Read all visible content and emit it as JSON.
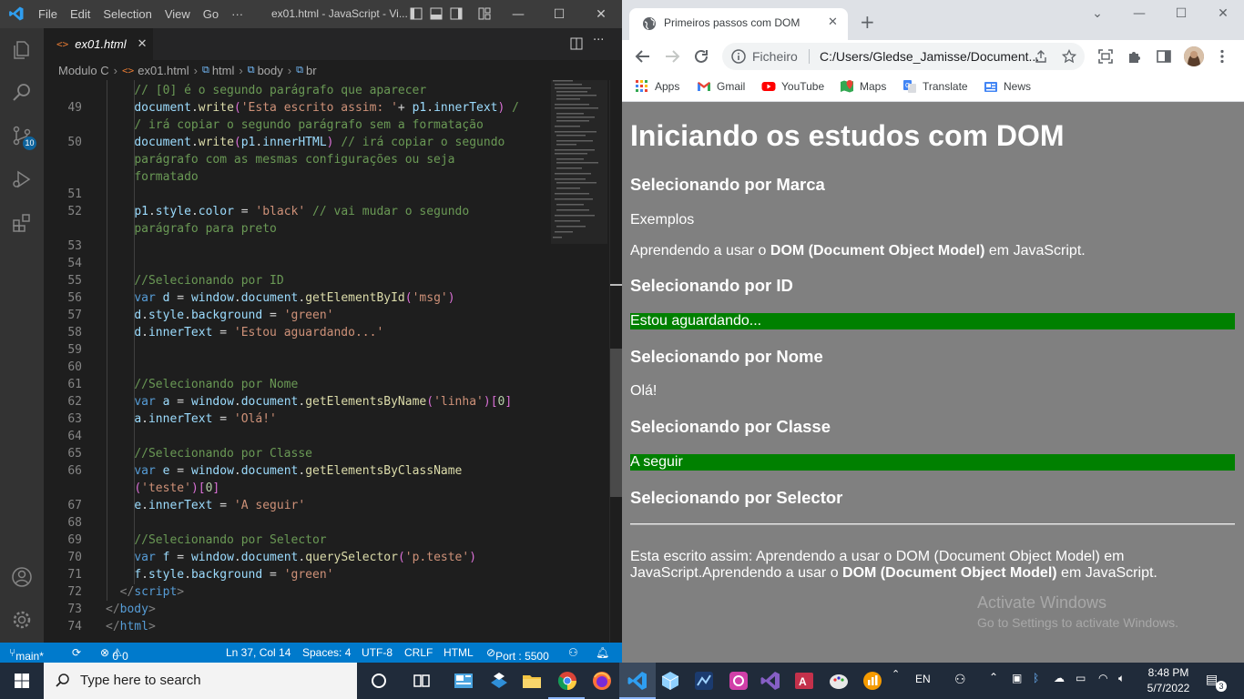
{
  "vscode": {
    "menu": [
      "File",
      "Edit",
      "Selection",
      "View",
      "Go",
      "···"
    ],
    "window_title": "ex01.html - JavaScript - Vi...",
    "tab": {
      "name": "ex01.html",
      "close": "✕"
    },
    "breadcrumb": [
      "Modulo C",
      "ex01.html",
      "html",
      "body",
      "br"
    ],
    "source_control_badge": "10",
    "code_lines": [
      {
        "num": "",
        "html": "    <span class=\"c\">// [0] é o segundo parágrafo que aparecer</span>"
      },
      {
        "num": "49",
        "html": "    <span class=\"v\">document</span>.<span class=\"f\">write</span><span class=\"br2\">(</span><span class=\"s\">'Esta escrito assim: '</span>+ <span class=\"v\">p1</span>.<span class=\"v\">innerText</span><span class=\"br2\">)</span> <span class=\"c\">/</span>"
      },
      {
        "num": "",
        "html": "    <span class=\"c\">/ irá copiar o segundo parágrafo sem a formatação</span>"
      },
      {
        "num": "50",
        "html": "    <span class=\"v\">document</span>.<span class=\"f\">write</span><span class=\"br2\">(</span><span class=\"v\">p1</span>.<span class=\"v\">innerHTML</span><span class=\"br2\">)</span> <span class=\"c\">// irá copiar o segundo</span>"
      },
      {
        "num": "",
        "html": "    <span class=\"c\">parágrafo com as mesmas configurações ou seja</span>"
      },
      {
        "num": "",
        "html": "    <span class=\"c\">formatado</span>"
      },
      {
        "num": "51",
        "html": ""
      },
      {
        "num": "52",
        "html": "    <span class=\"v\">p1</span>.<span class=\"v\">style</span>.<span class=\"v\">color</span> = <span class=\"s\">'black'</span> <span class=\"c\">// vai mudar o segundo</span>"
      },
      {
        "num": "",
        "html": "    <span class=\"c\">parágrafo para preto</span>"
      },
      {
        "num": "53",
        "html": ""
      },
      {
        "num": "54",
        "html": ""
      },
      {
        "num": "55",
        "html": "    <span class=\"c\">//Selecionando por ID</span>"
      },
      {
        "num": "56",
        "html": "    <span class=\"k\">var</span> <span class=\"v\">d</span> = <span class=\"v\">window</span>.<span class=\"v\">document</span>.<span class=\"f\">getElementById</span><span class=\"br2\">(</span><span class=\"s\">'msg'</span><span class=\"br2\">)</span>"
      },
      {
        "num": "57",
        "html": "    <span class=\"v\">d</span>.<span class=\"v\">style</span>.<span class=\"v\">background</span> = <span class=\"s\">'green'</span>"
      },
      {
        "num": "58",
        "html": "    <span class=\"v\">d</span>.<span class=\"v\">innerText</span> = <span class=\"s\">'Estou aguardando...'</span>"
      },
      {
        "num": "59",
        "html": ""
      },
      {
        "num": "60",
        "html": ""
      },
      {
        "num": "61",
        "html": "    <span class=\"c\">//Selecionando por Nome</span>"
      },
      {
        "num": "62",
        "html": "    <span class=\"k\">var</span> <span class=\"v\">a</span> = <span class=\"v\">window</span>.<span class=\"v\">document</span>.<span class=\"f\">getElementsByName</span><span class=\"br2\">(</span><span class=\"s\">'linha'</span><span class=\"br2\">)</span><span class=\"br2\">[</span><span class=\"n\">0</span><span class=\"br2\">]</span>"
      },
      {
        "num": "63",
        "html": "    <span class=\"v\">a</span>.<span class=\"v\">innerText</span> = <span class=\"s\">'Olá!'</span>"
      },
      {
        "num": "64",
        "html": ""
      },
      {
        "num": "65",
        "html": "    <span class=\"c\">//Selecionando por Classe</span>"
      },
      {
        "num": "66",
        "html": "    <span class=\"k\">var</span> <span class=\"v\">e</span> = <span class=\"v\">window</span>.<span class=\"v\">document</span>.<span class=\"f\">getElementsByClassName</span>"
      },
      {
        "num": "",
        "html": "    <span class=\"br2\">(</span><span class=\"s\">'teste'</span><span class=\"br2\">)</span><span class=\"br2\">[</span><span class=\"n\">0</span><span class=\"br2\">]</span>"
      },
      {
        "num": "67",
        "html": "    <span class=\"v\">e</span>.<span class=\"v\">innerText</span> = <span class=\"s\">'A seguir'</span>"
      },
      {
        "num": "68",
        "html": ""
      },
      {
        "num": "69",
        "html": "    <span class=\"c\">//Selecionando por Selector</span>"
      },
      {
        "num": "70",
        "html": "    <span class=\"k\">var</span> <span class=\"v\">f</span> = <span class=\"v\">window</span>.<span class=\"v\">document</span>.<span class=\"f\">querySelector</span><span class=\"br2\">(</span><span class=\"s\">'p.teste'</span><span class=\"br2\">)</span>"
      },
      {
        "num": "71",
        "html": "    <span class=\"v\">f</span>.<span class=\"v\">style</span>.<span class=\"v\">background</span> = <span class=\"s\">'green'</span>"
      },
      {
        "num": "72",
        "html": "  <span class=\"t\">&lt;/</span><span class=\"k\">script</span><span class=\"t\">&gt;</span>"
      },
      {
        "num": "73",
        "html": "<span class=\"t\">&lt;/</span><span class=\"k\">body</span><span class=\"t\">&gt;</span>"
      },
      {
        "num": "74",
        "html": "<span class=\"t\">&lt;/</span><span class=\"k\">html</span><span class=\"t\">&gt;</span>"
      }
    ],
    "status": {
      "branch": "main*",
      "problems": "0",
      "warnings": "0",
      "position": "Ln 37, Col 14",
      "spaces": "Spaces: 4",
      "encoding": "UTF-8",
      "eol": "CRLF",
      "language": "HTML",
      "port": "Port : 5500"
    }
  },
  "chrome": {
    "tab_title": "Primeiros passos com DOM",
    "scheme": "Ficheiro",
    "url": "C:/Users/Gledse_Jamisse/Document...",
    "bookmarks": [
      "Apps",
      "Gmail",
      "YouTube",
      "Maps",
      "Translate",
      "News"
    ],
    "page": {
      "h1": "Iniciando os estudos com DOM",
      "h_marca": "Selecionando por Marca",
      "exemplos": "Exemplos",
      "aprendendo_pre": "Aprendendo a usar o ",
      "aprendendo_bold": "DOM (Document Object Model)",
      "aprendendo_post": " em JavaScript.",
      "h_id": "Selecionando por ID",
      "msg": "Estou aguardando...",
      "h_nome": "Selecionando por Nome",
      "ola": "Olá!",
      "h_classe": "Selecionando por Classe",
      "a_seguir": "A seguir",
      "h_selector": "Selecionando por Selector",
      "written_line1": "Esta escrito assim: Aprendendo a usar o DOM (Document Object Model) em",
      "written_line2_pre": "JavaScript.Aprendendo a usar o ",
      "written_line2_bold": "DOM (Document Object Model)",
      "written_line2_post": " em JavaScript."
    },
    "watermark": {
      "line1": "Activate Windows",
      "line2": "Go to Settings to activate Windows."
    }
  },
  "taskbar": {
    "search_placeholder": "Type here to search",
    "lang": "EN",
    "time": "8:48 PM",
    "date": "5/7/2022",
    "notifications": "3"
  }
}
